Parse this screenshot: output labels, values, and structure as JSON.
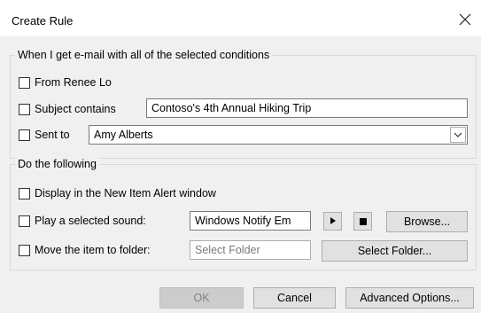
{
  "dialog": {
    "title": "Create Rule"
  },
  "conditions": {
    "legend": "When I get e-mail with all of the selected conditions",
    "from_label": "From Renee Lo",
    "subject_label": "Subject contains",
    "subject_value": "Contoso's 4th Annual Hiking Trip",
    "sent_to_label": "Sent to",
    "sent_to_value": "Amy Alberts"
  },
  "actions": {
    "legend": "Do the following",
    "alert_label": "Display in the New Item Alert window",
    "sound_label": "Play a selected sound:",
    "sound_value": "Windows Notify Em",
    "browse_label": "Browse...",
    "move_label": "Move the item to folder:",
    "folder_placeholder": "Select Folder",
    "select_folder_label": "Select Folder..."
  },
  "footer": {
    "ok_label": "OK",
    "cancel_label": "Cancel",
    "advanced_label": "Advanced Options..."
  },
  "icons": {
    "close": "close-icon",
    "dropdown": "chevron-down-icon",
    "play": "play-icon",
    "stop": "stop-icon"
  }
}
